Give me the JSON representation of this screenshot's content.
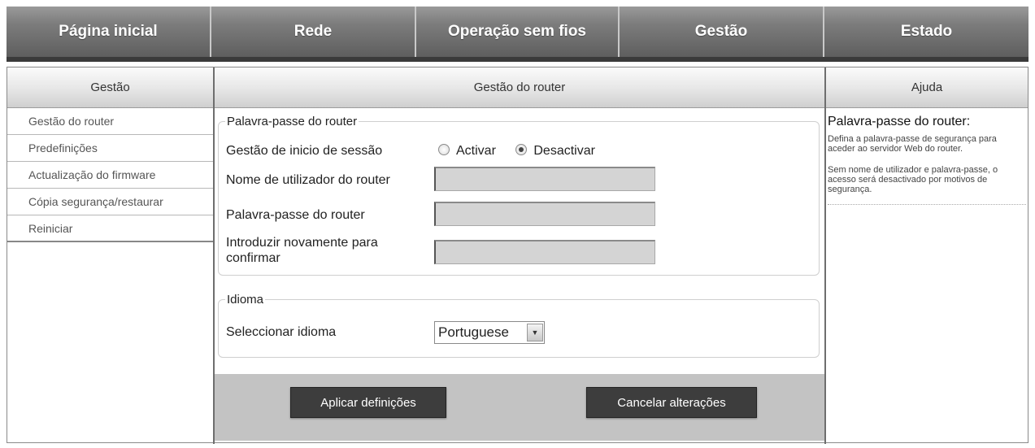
{
  "topnav": {
    "tabs": [
      "Página inicial",
      "Rede",
      "Operação sem fios",
      "Gestão",
      "Estado"
    ]
  },
  "sidebar": {
    "title": "Gestão",
    "items": [
      "Gestão do router",
      "Predefinições",
      "Actualização do firmware",
      "Cópia segurança/restaurar",
      "Reiniciar"
    ]
  },
  "main": {
    "title": "Gestão do router",
    "password_group": {
      "legend": "Palavra-passe do router",
      "login_label": "Gestão de inicio de sessão",
      "radio_enable": "Activar",
      "radio_disable": "Desactivar",
      "selected": "Desactivar",
      "username_label": "Nome de utilizador do router",
      "username_value": "",
      "password_label": "Palavra-passe do router",
      "password_value": "",
      "confirm_label_line1": "Introduzir novamente para",
      "confirm_label_line2": "confirmar",
      "confirm_value": ""
    },
    "language_group": {
      "legend": "Idioma",
      "select_label": "Seleccionar idioma",
      "selected_language": "Portuguese"
    },
    "buttons": {
      "apply": "Aplicar definições",
      "cancel": "Cancelar alterações"
    }
  },
  "help": {
    "title": "Ajuda",
    "heading": "Palavra-passe do router:",
    "paragraph1": "Defina a palavra-passe de segurança para aceder ao servidor Web do router.",
    "paragraph2": "Sem nome de utilizador e palavra-passe, o acesso será desactivado por motivos de segurança."
  },
  "colors": {
    "nav_bg": "#7c7c7c",
    "button_bg": "#3d3d3d",
    "action_bar": "#c3c3c3"
  }
}
